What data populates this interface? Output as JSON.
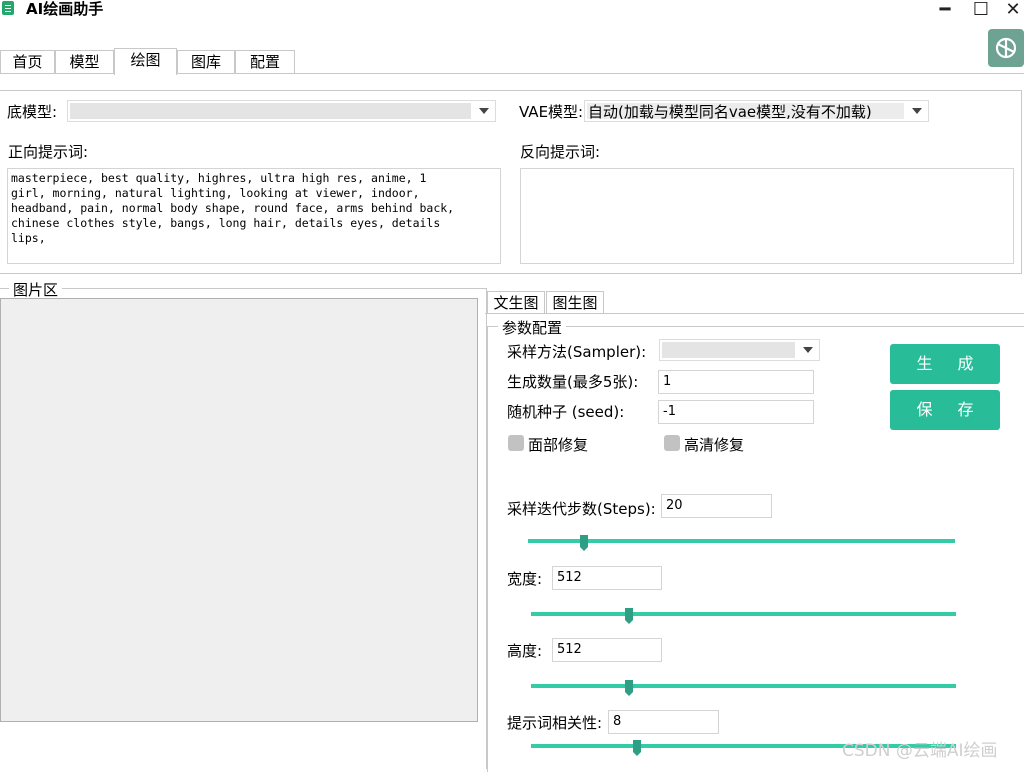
{
  "app": {
    "title": "AI绘画助手"
  },
  "window": {
    "minimize": "━",
    "maximize": "☐",
    "close": "✕"
  },
  "tabs": [
    "首页",
    "模型",
    "绘图",
    "图库",
    "配置"
  ],
  "active_tab": "绘图",
  "base_model": {
    "label": "底模型:",
    "value": ""
  },
  "vae_model": {
    "label": "VAE模型:",
    "value": "自动(加载与模型同名vae模型,没有不加载)"
  },
  "positive_prompt": {
    "label": "正向提示词:",
    "value": "masterpiece, best quality, highres, ultra high res, anime, 1\ngirl, morning, natural lighting, looking at viewer, indoor,\nheadband, pain, normal body shape, round face, arms behind back,\nchinese clothes style, bangs, long hair, details eyes, details\nlips,"
  },
  "negative_prompt": {
    "label": "反向提示词:",
    "value": ""
  },
  "image_area": {
    "label": "图片区"
  },
  "sub_tabs": [
    "文生图",
    "图生图"
  ],
  "params": {
    "group_label": "参数配置",
    "sampler": {
      "label": "采样方法(Sampler):",
      "value": ""
    },
    "batch": {
      "label": "生成数量(最多5张):",
      "value": "1"
    },
    "seed": {
      "label": "随机种子 (seed):",
      "value": "-1"
    },
    "face_fix": {
      "label": "面部修复",
      "checked": false
    },
    "hires_fix": {
      "label": "高清修复",
      "checked": false
    },
    "steps": {
      "label": "采样迭代步数(Steps):",
      "value": "20",
      "slider_fraction": 0.13
    },
    "width": {
      "label": "宽度:",
      "value": "512",
      "slider_fraction": 0.23
    },
    "height": {
      "label": "高度:",
      "value": "512",
      "slider_fraction": 0.23
    },
    "cfg": {
      "label": "提示词相关性:",
      "value": "8",
      "slider_fraction": 0.25
    }
  },
  "buttons": {
    "generate": "生 成",
    "save": "保 存"
  },
  "watermark": "CSDN @云端AI绘画",
  "colors": {
    "accent": "#28bd98",
    "slider": "#33cca7"
  }
}
